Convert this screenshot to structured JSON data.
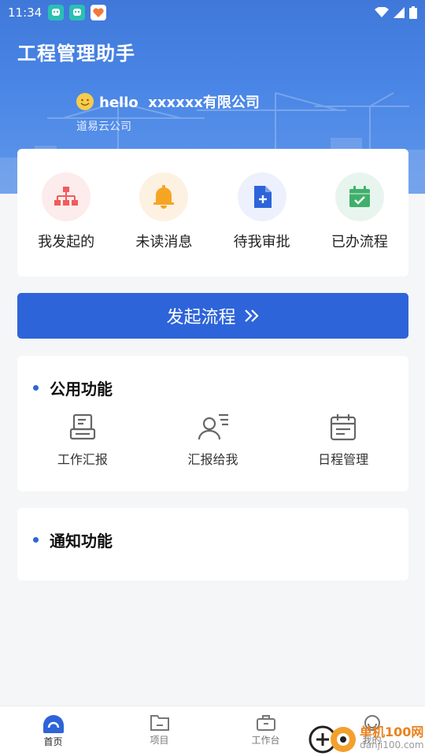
{
  "status_bar": {
    "time": "11:34"
  },
  "header": {
    "app_title": "工程管理助手",
    "greeting": "hello  xxxxxx有限公司",
    "company": "道易云公司"
  },
  "quick_actions": [
    {
      "label": "我发起的",
      "icon": "org-chart-icon",
      "color": "#f35a5a",
      "bg": "#fdecec"
    },
    {
      "label": "未读消息",
      "icon": "bell-icon",
      "color": "#f5a524",
      "bg": "#fdf1e1"
    },
    {
      "label": "待我审批",
      "icon": "document-plus-icon",
      "color": "#2e64d9",
      "bg": "#ecf1fd"
    },
    {
      "label": "已办流程",
      "icon": "calendar-check-icon",
      "color": "#3fb06b",
      "bg": "#e8f5ee"
    }
  ],
  "start_button": {
    "label": "发起流程"
  },
  "public_functions": {
    "title": "公用功能",
    "items": [
      {
        "label": "工作汇报",
        "icon": "report-icon"
      },
      {
        "label": "汇报给我",
        "icon": "user-list-icon"
      },
      {
        "label": "日程管理",
        "icon": "calendar-icon"
      }
    ]
  },
  "notify_functions": {
    "title": "通知功能"
  },
  "tabbar": [
    {
      "label": "首页",
      "icon": "home-icon",
      "active": true
    },
    {
      "label": "项目",
      "icon": "folder-icon",
      "active": false
    },
    {
      "label": "工作台",
      "icon": "briefcase-icon",
      "active": false
    },
    {
      "label": "我的",
      "icon": "user-icon",
      "active": false
    }
  ],
  "watermark": {
    "name": "单机100网",
    "url": "danji100.com"
  },
  "colors": {
    "primary": "#2e64d9",
    "background": "#f5f6f8"
  }
}
